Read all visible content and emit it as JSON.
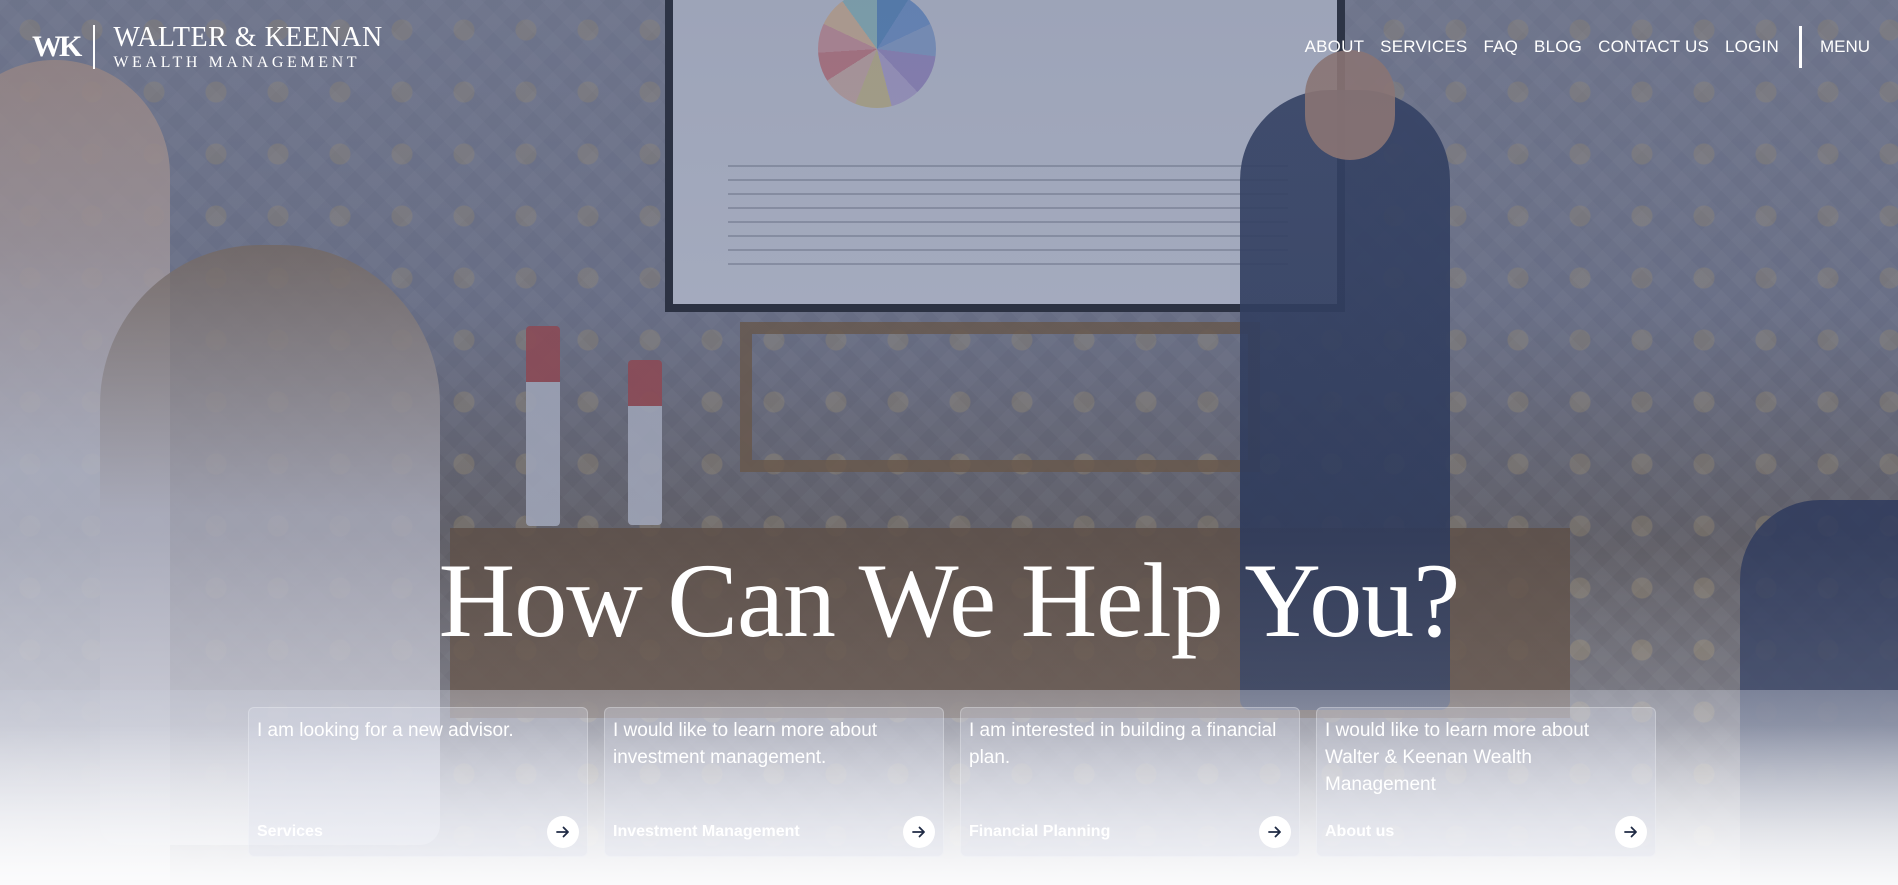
{
  "header": {
    "logo": {
      "mark": "WK",
      "line1": "WALTER & KEENAN",
      "line2": "WEALTH MANAGEMENT"
    },
    "nav": [
      {
        "label": "ABOUT"
      },
      {
        "label": "SERVICES"
      },
      {
        "label": "FAQ"
      },
      {
        "label": "BLOG"
      },
      {
        "label": "CONTACT US"
      },
      {
        "label": "LOGIN"
      }
    ],
    "menu_label": "MENU"
  },
  "hero": {
    "headline": "How Can We Help You?"
  },
  "cards": [
    {
      "question": "I am looking for a new advisor.",
      "link": "Services",
      "icon": "arrow-right-icon"
    },
    {
      "question": "I would like to learn more about investment management.",
      "link": "Investment Management",
      "icon": "arrow-right-icon"
    },
    {
      "question": "I am interested in building a financial plan.",
      "link": "Financial Planning",
      "icon": "arrow-right-icon"
    },
    {
      "question": "I would like to learn more about Walter & Keenan Wealth Management",
      "link": "About us",
      "icon": "arrow-right-icon"
    }
  ],
  "colors": {
    "text": "#ffffff",
    "overlay_tint": "#3e4a6e",
    "arrow": "#1f2a44"
  }
}
